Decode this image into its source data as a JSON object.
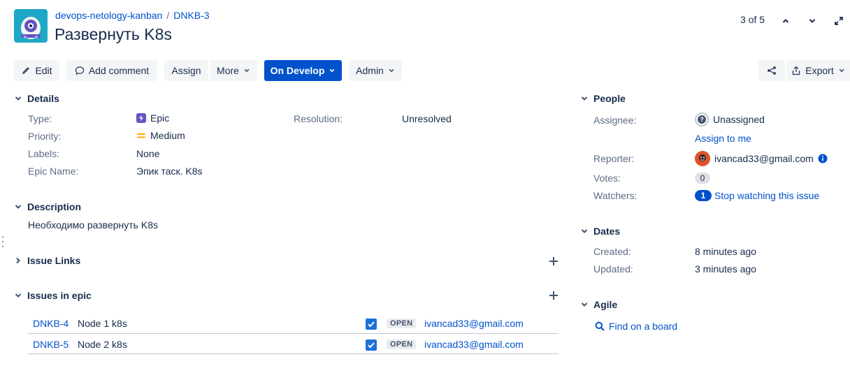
{
  "header": {
    "project": "devops-netology-kanban",
    "separator": "/",
    "issue_key": "DNKB-3",
    "title": "Развернуть K8s",
    "pager": "3 of 5"
  },
  "toolbar": {
    "edit": "Edit",
    "add_comment": "Add comment",
    "assign": "Assign",
    "more": "More",
    "status": "On Develop",
    "admin": "Admin",
    "export": "Export"
  },
  "details": {
    "heading": "Details",
    "type_label": "Type:",
    "type_value": "Epic",
    "priority_label": "Priority:",
    "priority_value": "Medium",
    "labels_label": "Labels:",
    "labels_value": "None",
    "epic_name_label": "Epic Name:",
    "epic_name_value": "Эпик таск. K8s",
    "resolution_label": "Resolution:",
    "resolution_value": "Unresolved"
  },
  "description": {
    "heading": "Description",
    "text": "Необходимо развернуть K8s"
  },
  "issue_links": {
    "heading": "Issue Links"
  },
  "issues_in_epic": {
    "heading": "Issues in epic",
    "rows": [
      {
        "key": "DNKB-4",
        "summary": "Node 1 k8s",
        "status": "OPEN",
        "assignee": "ivancad33@gmail.com"
      },
      {
        "key": "DNKB-5",
        "summary": "Node 2 k8s",
        "status": "OPEN",
        "assignee": "ivancad33@gmail.com"
      }
    ]
  },
  "people": {
    "heading": "People",
    "assignee_label": "Assignee:",
    "assignee_value": "Unassigned",
    "assign_to_me": "Assign to me",
    "reporter_label": "Reporter:",
    "reporter_value": "ivancad33@gmail.com",
    "votes_label": "Votes:",
    "votes_value": "0",
    "watchers_label": "Watchers:",
    "watchers_count": "1",
    "watch_action": "Stop watching this issue"
  },
  "dates": {
    "heading": "Dates",
    "created_label": "Created:",
    "created_value": "8 minutes ago",
    "updated_label": "Updated:",
    "updated_value": "3 minutes ago"
  },
  "agile": {
    "heading": "Agile",
    "find_on_board": "Find on a board"
  },
  "colors": {
    "primary": "#0052cc",
    "epic": "#6554c0",
    "priority_medium": "#ffab00",
    "checkbox": "#1e6fd9",
    "project_avatar": "#1fa7c7"
  },
  "icons": [
    "project-avatar-icon",
    "chevron-up-icon",
    "chevron-down-icon",
    "expand-icon",
    "pencil-icon",
    "comment-icon",
    "share-icon",
    "export-icon",
    "epic-icon",
    "medium-priority-icon",
    "plus-icon",
    "question-icon",
    "user-avatar-icon",
    "info-icon",
    "search-icon",
    "checkbox-icon"
  ]
}
